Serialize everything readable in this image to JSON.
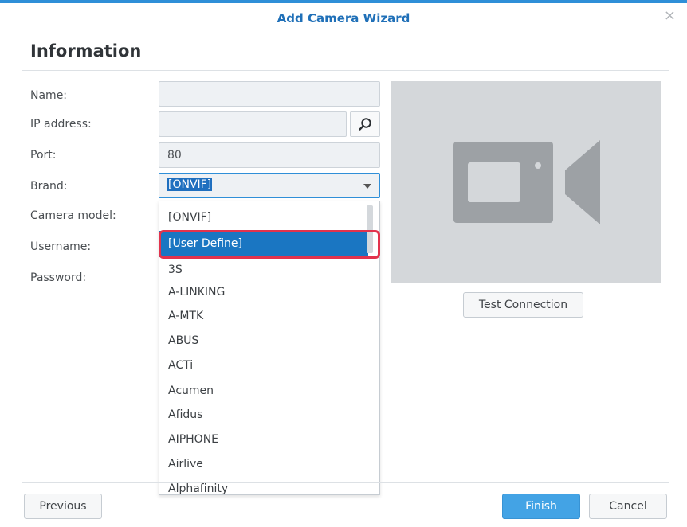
{
  "window": {
    "title": "Add Camera Wizard",
    "close_icon": "×"
  },
  "section": {
    "heading": "Information"
  },
  "form": {
    "name_label": "Name:",
    "name_value": "",
    "ip_label": "IP address:",
    "ip_value": "",
    "port_label": "Port:",
    "port_value": "80",
    "brand_label": "Brand:",
    "brand_value": "[ONVIF]",
    "camera_model_label": "Camera model:",
    "username_label": "Username:",
    "password_label": "Password:"
  },
  "brand_dropdown": {
    "items": [
      "[ONVIF]",
      "[User Define]",
      "3S",
      "A-LINKING",
      "A-MTK",
      "ABUS",
      "ACTi",
      "Acumen",
      "Afidus",
      "AIPHONE",
      "Airlive",
      "Alphafinity"
    ],
    "highlighted": "[User Define]"
  },
  "preview": {
    "test_connection_label": "Test Connection"
  },
  "footer": {
    "previous_label": "Previous",
    "finish_label": "Finish",
    "cancel_label": "Cancel"
  },
  "colors": {
    "accent": "#2f8fd8",
    "selection": "#1a76c2",
    "highlight_ring": "#e2334d",
    "primary_button": "#43a3e5"
  }
}
